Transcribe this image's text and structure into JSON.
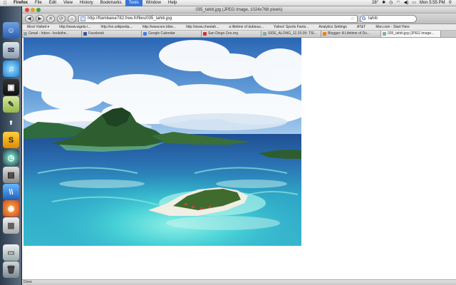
{
  "menubar": {
    "apple": "",
    "items": [
      "Firefox",
      "File",
      "Edit",
      "View",
      "History",
      "Bookmarks",
      "Tools",
      "Window",
      "Help"
    ],
    "temp": "28°",
    "clock": "Mon 5:55 PM"
  },
  "window": {
    "title": "035_tahiti.jpg (JPEG Image, 1024x768 pixels)"
  },
  "toolbar": {
    "back": "◀",
    "forward": "▶",
    "stop": "✕",
    "reload": "⟳",
    "home": "⌂",
    "url": "http://ftambaise782.free.fr/files/035_tahiti.jpg",
    "search_value": "tahiti"
  },
  "bookmarks": [
    "Most Visited ▾",
    "http://www.wgets-i...",
    "http://en.wikipedia...",
    "http://wwscore.tribe...",
    "http://www.cheetah...",
    "a lifetime of dubious...",
    "Yahoo! Sports Fants...",
    "Analytics Settings",
    "AT&T",
    "Msn.com - Start Here"
  ],
  "tabs": [
    "Gmail - Inbox - lexiluthe...",
    "Facebook",
    "Google Calendar",
    "San Diego Zoo.org",
    "SIDE_ALONG_12.20.09: TSI...",
    "Blogger: A Lifetime of Du...",
    "035_tahiti.jpg (JPEG Image..."
  ],
  "status": "Done",
  "colors": {
    "accent": "#3875d7",
    "sky_top": "#2f6fb8",
    "lagoon": "#3fc6cf"
  }
}
